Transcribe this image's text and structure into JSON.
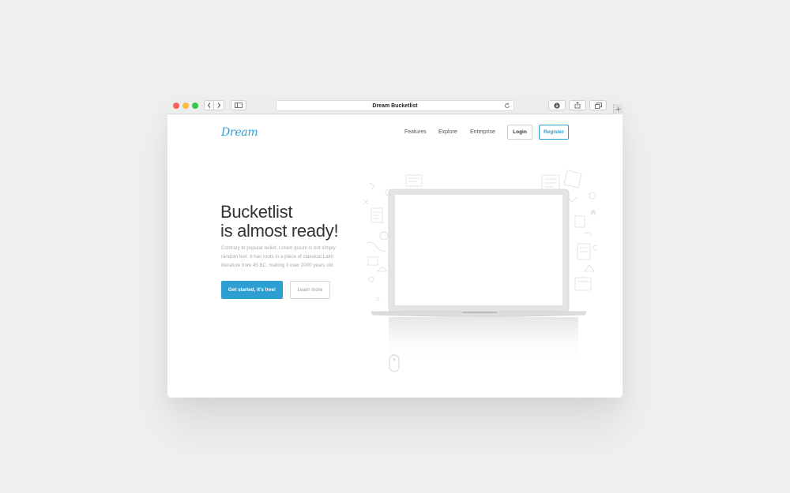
{
  "browser": {
    "url_title": "Dream Bucketlist",
    "traffic_colors": {
      "close": "#fc605c",
      "minimize": "#fdbc40",
      "zoom": "#34c84a"
    }
  },
  "site": {
    "logo": "Dream",
    "nav": {
      "features": "Features",
      "explore": "Explore",
      "enterprise": "Enterprise",
      "login": "Login",
      "register": "Register"
    },
    "accent_color": "#2d9fd3"
  },
  "hero": {
    "title_line1": "Bucketlist",
    "title_line2": "is almost ready!",
    "description": "Contrary to popular belief, Lorem Ipsum is not simply random text. It has roots in a piece of classical Latin literature from 45 BC, making it over 2000 years old.",
    "primary_cta": "Get started, it's free!",
    "secondary_cta": "Learn more"
  }
}
